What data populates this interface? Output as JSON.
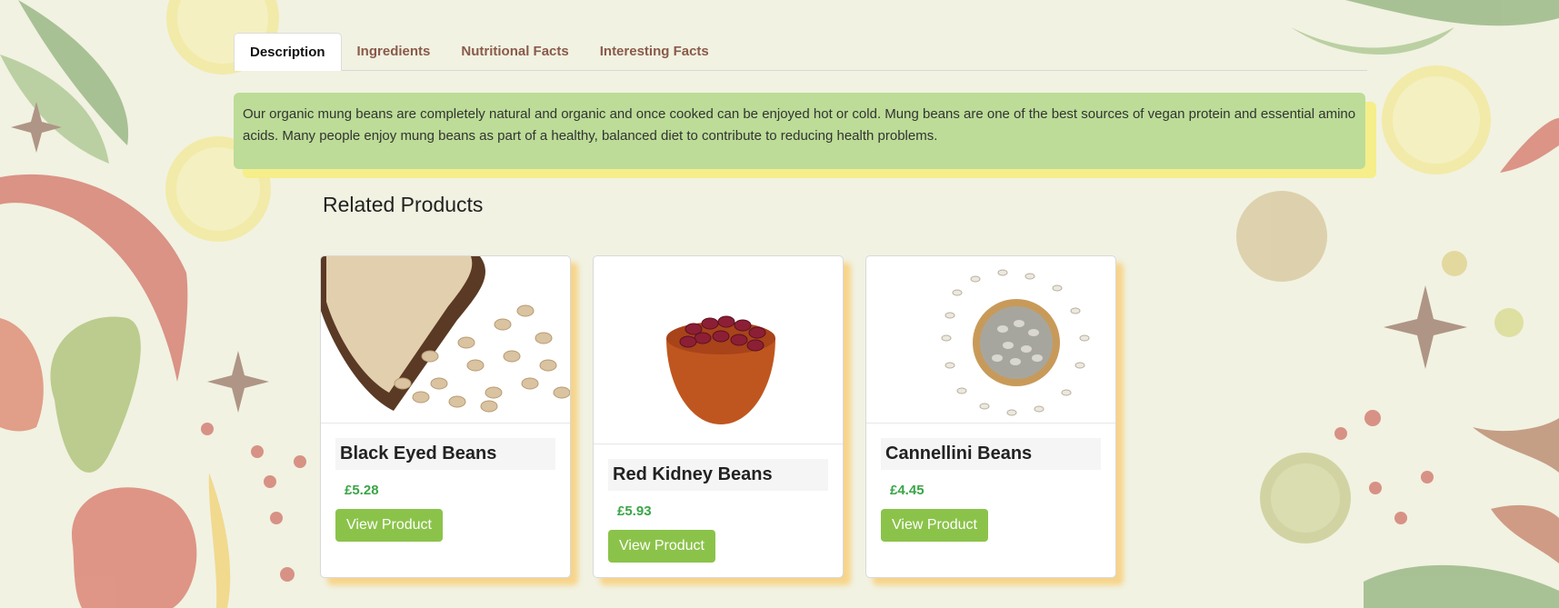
{
  "tabs": [
    {
      "label": "Description"
    },
    {
      "label": "Ingredients"
    },
    {
      "label": "Nutritional Facts"
    },
    {
      "label": "Interesting Facts"
    }
  ],
  "description": "Our organic mung beans are completely natural and organic and once cooked can be enjoyed hot or cold. Mung beans are one of the best sources of vegan protein and essential amino acids. Many people enjoy mung beans as part of a healthy, balanced diet to contribute to reducing health problems.",
  "related": {
    "title": "Related Products",
    "products": [
      {
        "name": "Black Eyed Beans",
        "price": "£5.28",
        "button": "View Product"
      },
      {
        "name": "Red Kidney Beans",
        "price": "£5.93",
        "button": "View Product"
      },
      {
        "name": "Cannellini Beans",
        "price": "£4.45",
        "button": "View Product"
      }
    ]
  },
  "colors": {
    "accent_green": "#8bc34a",
    "price_green": "#3aa547",
    "description_bg": "#bcdc97",
    "tab_text": "#8a5a4a"
  }
}
